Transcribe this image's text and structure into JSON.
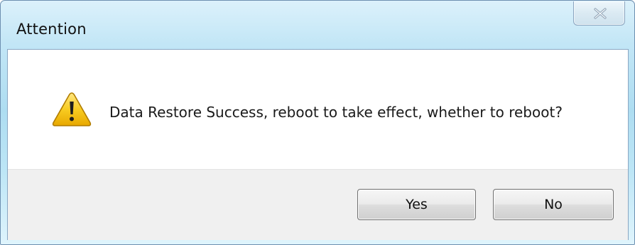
{
  "window": {
    "title": "Attention",
    "close_icon": "close-icon"
  },
  "dialog": {
    "icon": "warning-icon",
    "message": "Data Restore Success, reboot to take effect, whether to reboot?"
  },
  "buttons": {
    "yes_label": "Yes",
    "no_label": "No"
  },
  "colors": {
    "titlebar": "#bfe4f5",
    "footer": "#f0f0f0",
    "warning_fill": "#f5c518"
  }
}
